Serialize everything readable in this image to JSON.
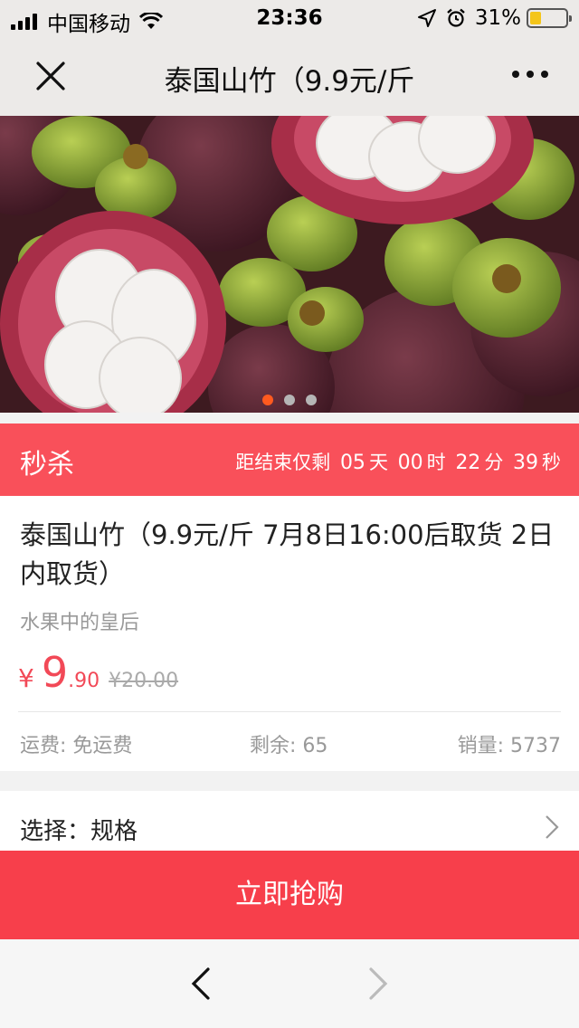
{
  "status_bar": {
    "carrier": "中国移动",
    "time": "23:36",
    "battery_percent": "31%",
    "battery_level": 0.31,
    "icons": [
      "signal-icon",
      "wifi-icon",
      "location-icon",
      "alarm-icon",
      "battery-icon"
    ]
  },
  "nav": {
    "title": "泰国山竹（9.9元/斤",
    "close_icon": "close-icon",
    "more_icon": "more-icon"
  },
  "carousel": {
    "total_slides": 3,
    "active_slide": 1
  },
  "flash_sale": {
    "label": "秒杀",
    "countdown_prefix": "距结束仅剩",
    "days": "05",
    "days_unit": "天",
    "hours": "00",
    "hours_unit": "时",
    "minutes": "22",
    "minutes_unit": "分",
    "seconds": "39",
    "seconds_unit": "秒"
  },
  "product": {
    "title": "泰国山竹（9.9元/斤 7月8日16:00后取货 2日内取货）",
    "subtitle": "水果中的皇后",
    "currency": "¥",
    "price_int": "9",
    "price_dec": ".90",
    "original_price": "¥20.00",
    "shipping": "运费: 免运费",
    "stock": "剩余: 65",
    "sales": "销量: 5737"
  },
  "spec": {
    "label": "选择：规格"
  },
  "buy": {
    "label": "立即抢购"
  },
  "colors": {
    "accent": "#f73f4b",
    "sale_bar": "#f9505a",
    "price": "#f24957",
    "active_dot": "#ff5a1f"
  }
}
